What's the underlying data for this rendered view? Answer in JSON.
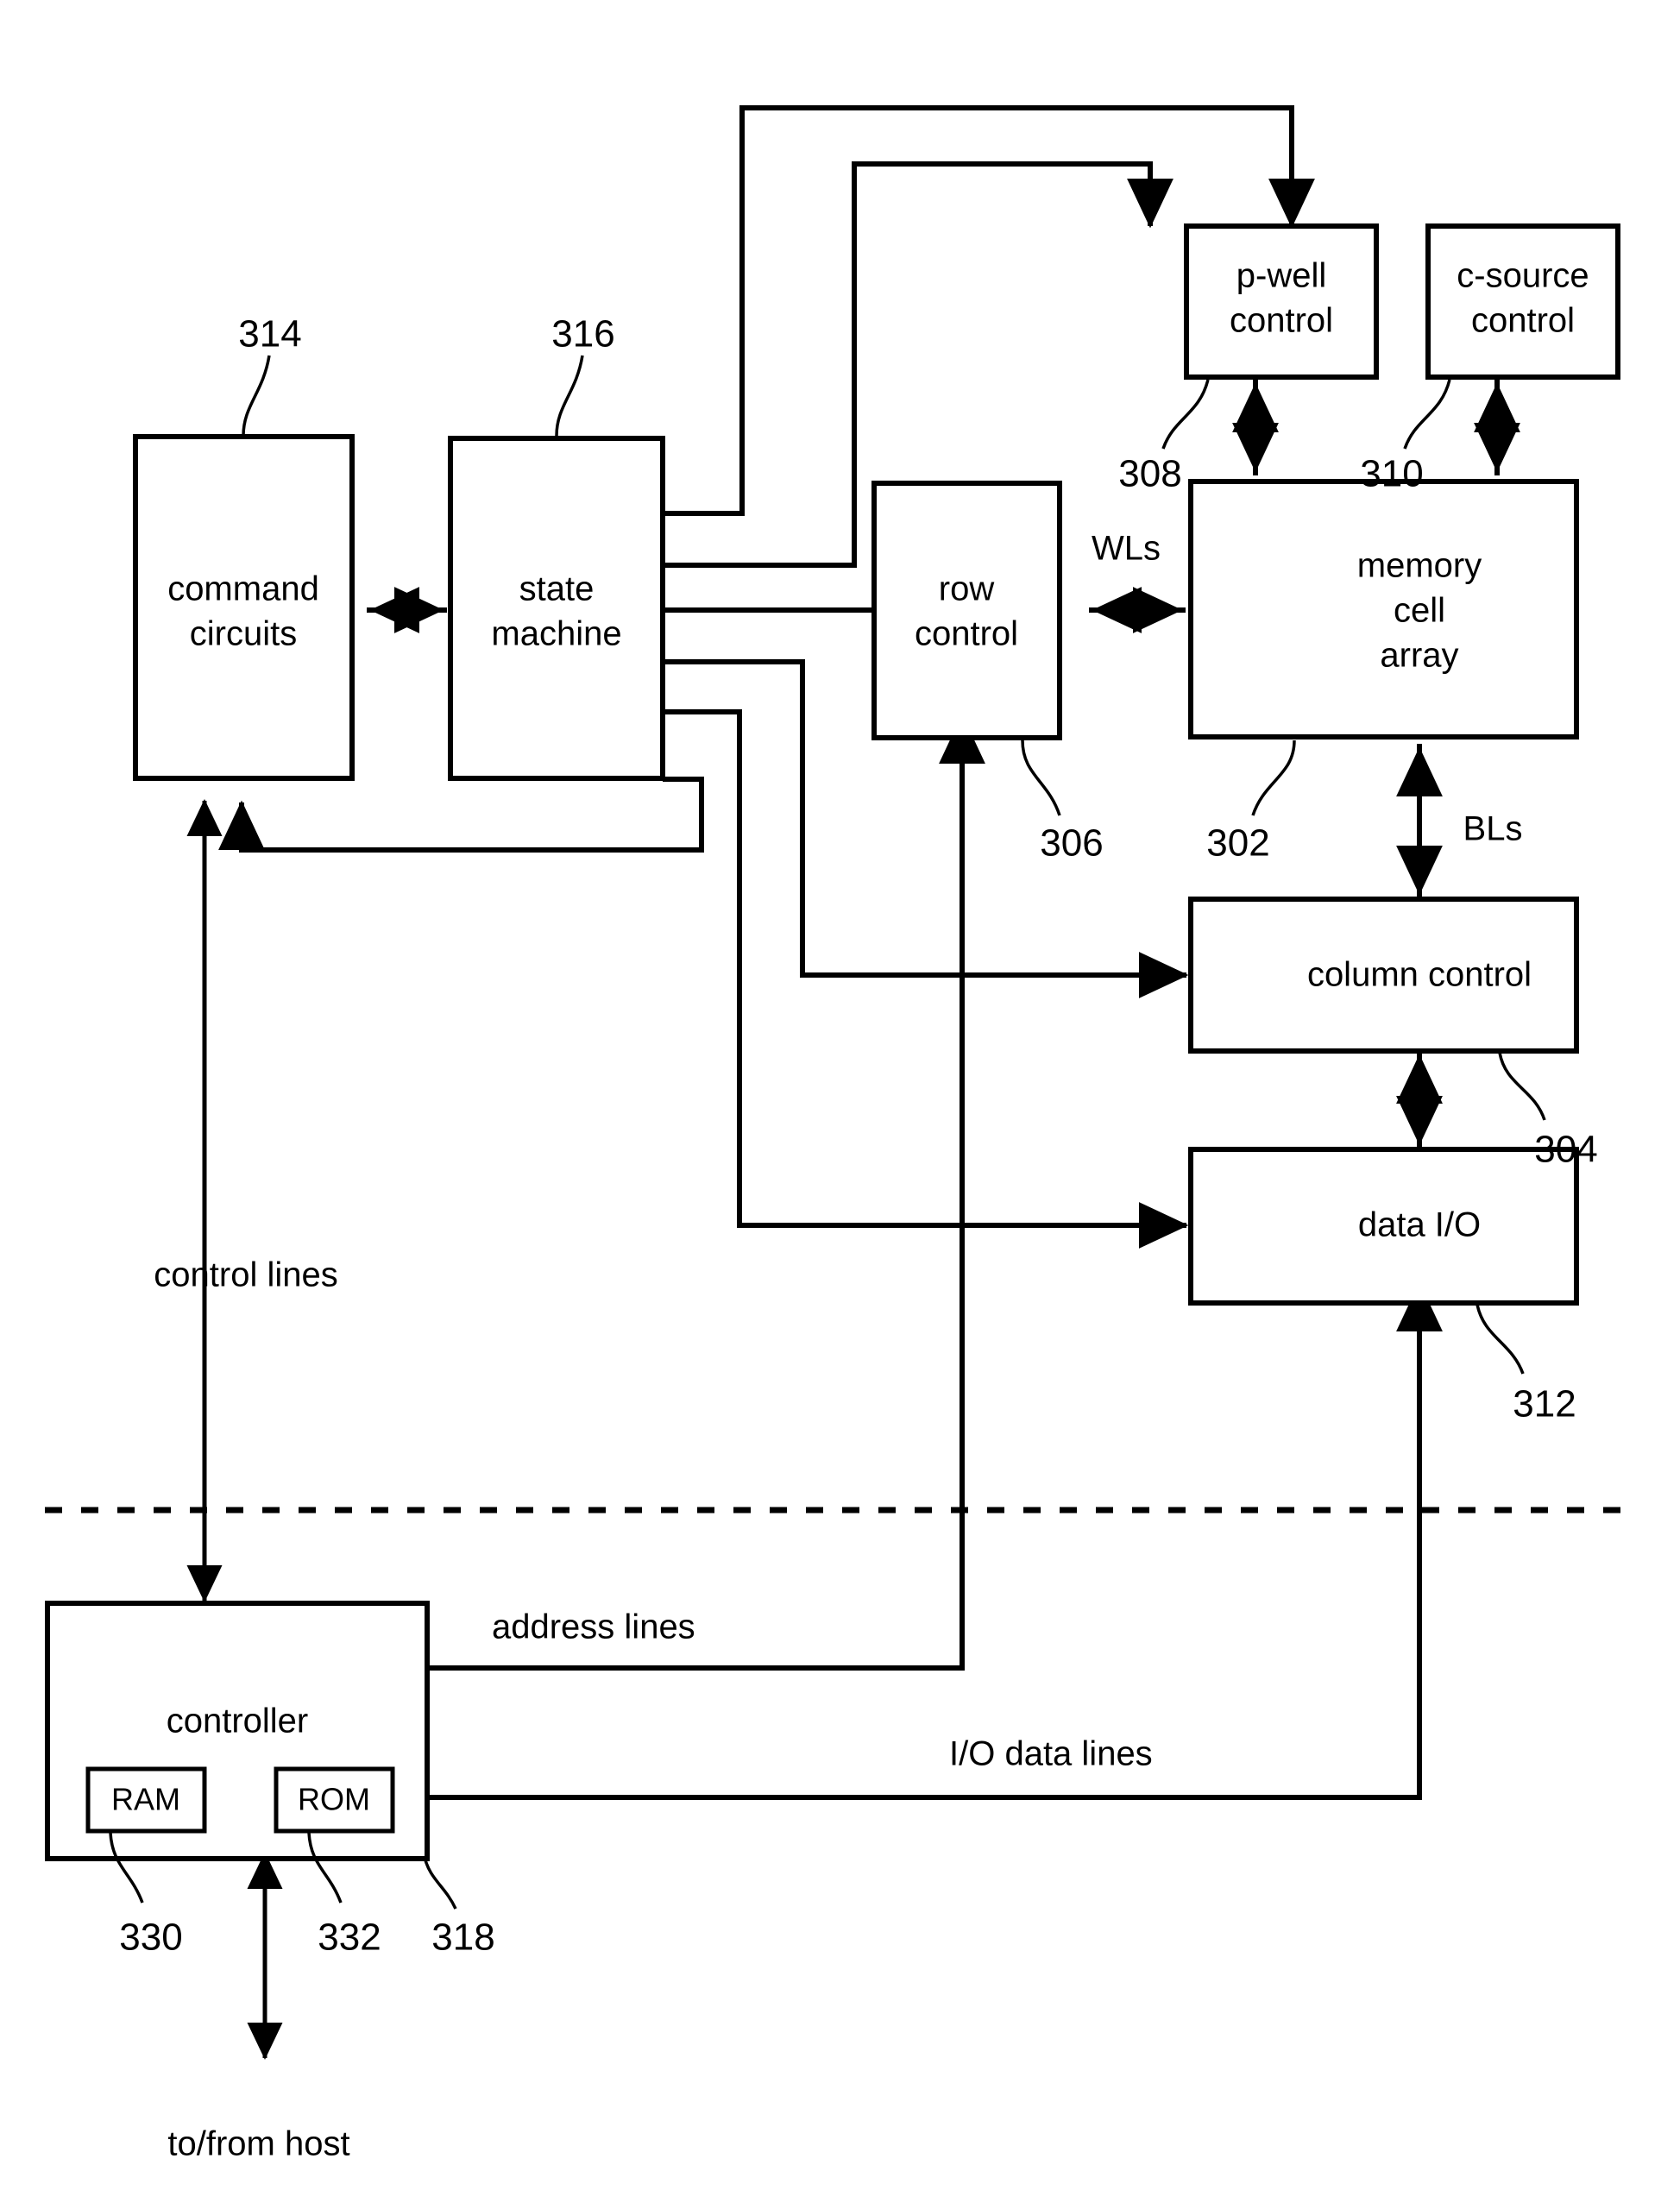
{
  "figure": {
    "type": "patent-block-diagram",
    "description": "Non-volatile memory system block diagram with controller and memory chip separated by a dashed boundary line"
  },
  "blocks": [
    {
      "id": "command_circuits",
      "label_lines": [
        "command",
        "circuits"
      ],
      "ref": "314"
    },
    {
      "id": "state_machine",
      "label_lines": [
        "state",
        "machine"
      ],
      "ref": "316"
    },
    {
      "id": "row_control",
      "label_lines": [
        "row",
        "control"
      ],
      "ref": "306"
    },
    {
      "id": "memory_cell_array",
      "label_lines": [
        "memory",
        "cell",
        "array"
      ],
      "ref": "302"
    },
    {
      "id": "p_well_control",
      "label_lines": [
        "p-well",
        "control"
      ],
      "ref": "308"
    },
    {
      "id": "c_source_control",
      "label_lines": [
        "c-source",
        "control"
      ],
      "ref": "310"
    },
    {
      "id": "column_control",
      "label_lines": [
        "column control"
      ],
      "ref": "304"
    },
    {
      "id": "data_io",
      "label_lines": [
        "data I/O"
      ],
      "ref": "312"
    },
    {
      "id": "controller",
      "label_lines": [
        "controller"
      ],
      "ref": "318"
    },
    {
      "id": "ram",
      "label_lines": [
        "RAM"
      ],
      "ref": "330"
    },
    {
      "id": "rom",
      "label_lines": [
        "ROM"
      ],
      "ref": "332"
    }
  ],
  "labels": {
    "command_circuits_1": "command",
    "command_circuits_2": "circuits",
    "state_machine_1": "state",
    "state_machine_2": "machine",
    "row_control_1": "row",
    "row_control_2": "control",
    "memory_cell_array_1": "memory",
    "memory_cell_array_2": "cell",
    "memory_cell_array_3": "array",
    "p_well_control_1": "p-well",
    "p_well_control_2": "control",
    "c_source_control_1": "c-source",
    "c_source_control_2": "control",
    "column_control": "column control",
    "data_io": "data I/O",
    "controller": "controller",
    "ram": "RAM",
    "rom": "ROM"
  },
  "signal_labels": {
    "wls": "WLs",
    "bls": "BLs",
    "control_lines": "control lines",
    "address_lines": "address lines",
    "io_data_lines": "I/O data lines",
    "to_from_host": "to/from host"
  },
  "reference_numerals": {
    "r302": "302",
    "r304": "304",
    "r306": "306",
    "r308": "308",
    "r310": "310",
    "r312": "312",
    "r314": "314",
    "r316": "316",
    "r318": "318",
    "r330": "330",
    "r332": "332"
  },
  "colors": {
    "ink": "#000000",
    "paper": "#ffffff"
  }
}
